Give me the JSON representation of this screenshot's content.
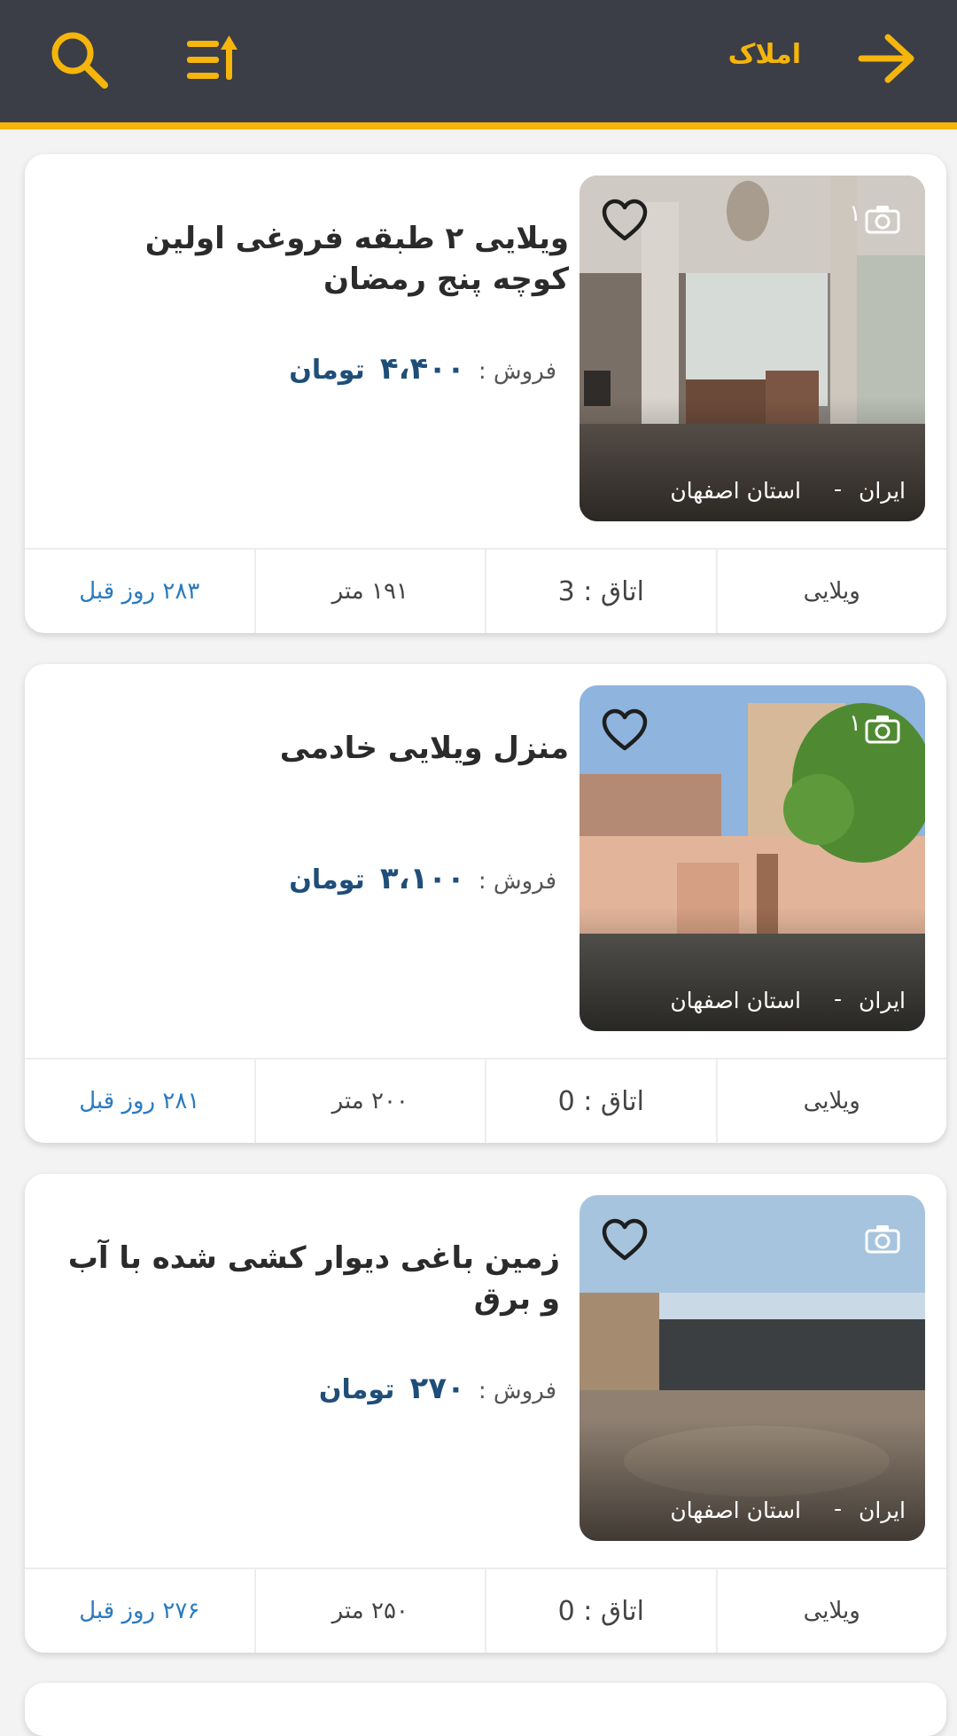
{
  "header": {
    "title": "املاک",
    "accent": "#f5b50b",
    "background": "#3b3e47",
    "icons": [
      "search-icon",
      "sort-icon",
      "back-arrow-icon"
    ]
  },
  "listings": [
    {
      "title": "ویلایی ۲ طبقه فروغی اولین کوچه پنج رمضان",
      "sale_label": "فروش :",
      "price": "۴،۴۰۰",
      "currency": "تومان",
      "photo_count": "۱",
      "country": "ایران",
      "separator": "-",
      "province": "استان اصفهان",
      "type": "ویلایی",
      "rooms": "اتاق : 3",
      "area": "۱۹۱ متر",
      "age": "۲۸۳ روز قبل"
    },
    {
      "title": "منزل ویلایی خادمی",
      "sale_label": "فروش :",
      "price": "۳،۱۰۰",
      "currency": "تومان",
      "photo_count": "۱",
      "country": "ایران",
      "separator": "-",
      "province": "استان اصفهان",
      "type": "ویلایی",
      "rooms": "اتاق : 0",
      "area": "۲۰۰ متر",
      "age": "۲۸۱ روز قبل"
    },
    {
      "title": "زمین باغی دیوار کشی شده با آب و برق",
      "sale_label": "فروش :",
      "price": "۲۷۰",
      "currency": "تومان",
      "photo_count": "",
      "country": "ایران",
      "separator": "-",
      "province": "استان اصفهان",
      "type": "ویلایی",
      "rooms": "اتاق : 0",
      "area": "۲۵۰ متر",
      "age": "۲۷۶ روز قبل"
    }
  ]
}
